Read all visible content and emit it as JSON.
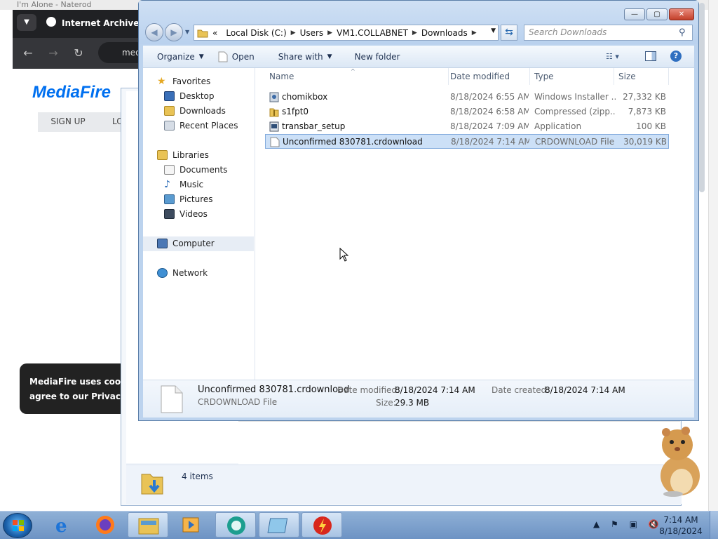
{
  "browser": {
    "title_faded": "I'm Alone - Naterod",
    "tab_title": "Internet Archive: Di",
    "url_text": "med",
    "mediafire_logo": "MediaFire",
    "sign_up": "SIGN UP",
    "login_partial": "LO",
    "cookie_line1": "MediaFire uses cookie",
    "cookie_line2": "agree to our Privacy P"
  },
  "explorer": {
    "window_buttons": {
      "minimize": "—",
      "maximize": "▢",
      "close": "✕"
    },
    "address": {
      "prefix": "«",
      "crumbs": [
        "Local Disk (C:)",
        "Users",
        "VM1.COLLABNET",
        "Downloads"
      ]
    },
    "search_placeholder": "Search Downloads",
    "toolbar": {
      "organize": "Organize",
      "open": "Open",
      "share_with": "Share with",
      "new_folder": "New folder"
    },
    "nav": {
      "favorites": "Favorites",
      "desktop": "Desktop",
      "downloads": "Downloads",
      "recent_places": "Recent Places",
      "libraries": "Libraries",
      "documents": "Documents",
      "music": "Music",
      "pictures": "Pictures",
      "videos": "Videos",
      "computer": "Computer",
      "network": "Network"
    },
    "columns": {
      "name": "Name",
      "date": "Date modified",
      "type": "Type",
      "size": "Size"
    },
    "files": [
      {
        "name": "chomikbox",
        "date": "8/18/2024 6:55 AM",
        "type": "Windows Installer ...",
        "size": "27,332 KB",
        "icon": "installer-icon"
      },
      {
        "name": "s1fpt0",
        "date": "8/18/2024 6:58 AM",
        "type": "Compressed (zipp...",
        "size": "7,873 KB",
        "icon": "zip-folder-icon"
      },
      {
        "name": "transbar_setup",
        "date": "8/18/2024 7:09 AM",
        "type": "Application",
        "size": "100 KB",
        "icon": "setup-exe-icon"
      },
      {
        "name": "Unconfirmed 830781.crdownload",
        "date": "8/18/2024 7:14 AM",
        "type": "CRDOWNLOAD File",
        "size": "30,019 KB",
        "icon": "blank-file-icon"
      }
    ],
    "details": {
      "filename": "Unconfirmed 830781.crdownload",
      "filetype": "CRDOWNLOAD File",
      "date_modified_label": "Date modified:",
      "date_modified": "8/18/2024 7:14 AM",
      "date_created_label": "Date created:",
      "date_created": "8/18/2024 7:14 AM",
      "size_label": "Size:",
      "size": "29.3 MB"
    }
  },
  "background_window": {
    "item_count": "4 items"
  },
  "taskbar": {
    "time": "7:14 AM",
    "date": "8/18/2024",
    "tray_icons": "▲ ⚑ ▣ 🔇"
  },
  "colors": {
    "window_frame": "#bcd3ee",
    "selection": "#cce0f7",
    "taskbar": "#6d93c4",
    "close_button": "#c3402a"
  }
}
